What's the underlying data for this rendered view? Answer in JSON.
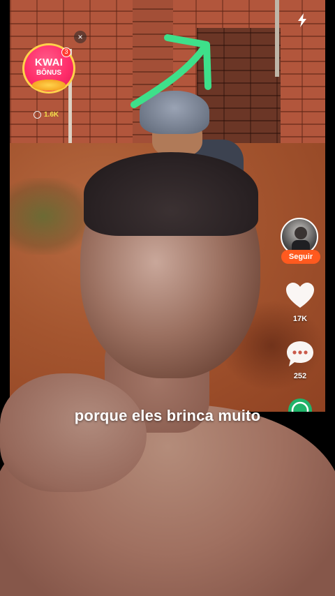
{
  "bonus": {
    "title": "KWAI",
    "subtitle": "BÔNUS",
    "notification_count": "3",
    "amount": "1.6K",
    "close_symbol": "×",
    "color_primary": "#ff2d6a",
    "color_ring": "#ffd24a"
  },
  "profile": {
    "follow_label": "Seguir",
    "follow_color": "#ff5a1f"
  },
  "actions": {
    "like_count": "17K",
    "comment_count": "252"
  },
  "caption": {
    "text": "porque eles brinca muito"
  },
  "annotations": {
    "arrow_color": "#3ee08a"
  },
  "icons": [
    "close-icon",
    "coin-icon",
    "flash-icon",
    "arrow-icon",
    "heart-icon",
    "comment-icon",
    "share-icon"
  ]
}
